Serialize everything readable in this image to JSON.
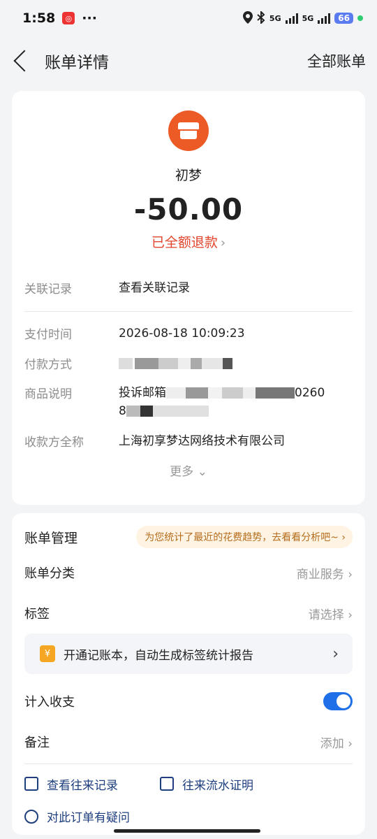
{
  "status_bar": {
    "time": "1:58",
    "dots": "···",
    "net_1": "5G",
    "net_2": "5G",
    "battery": "66"
  },
  "nav": {
    "title": "账单详情",
    "right_link": "全部账单"
  },
  "bill": {
    "merchant": "初梦",
    "amount": "-50.00",
    "refund_status": "已全额退款",
    "related_label": "关联记录",
    "related_link": "查看关联记录",
    "pay_time_label": "支付时间",
    "pay_time": "2026-08-18 10:09:23",
    "pay_method_label": "付款方式",
    "goods_label": "商品说明",
    "goods_visible_start": "投诉邮箱",
    "goods_visible_end": "0260",
    "goods_line2_start": "8",
    "payee_label": "收款方全称",
    "payee": "上海初享梦达网络技术有限公司",
    "more": "更多"
  },
  "management": {
    "title": "账单管理",
    "tip": "为您统计了最近的花费趋势，去看看分析吧~",
    "category_label": "账单分类",
    "category_value": "商业服务",
    "tag_label": "标签",
    "tag_value": "请选择",
    "promo_icon": "¥",
    "promo_text": "开通记账本，自动生成标签统计报告",
    "income_label": "计入收支",
    "income_enabled": true,
    "note_label": "备注",
    "note_value": "添加",
    "action_records": "查看往来记录",
    "action_proof": "往来流水证明",
    "action_question": "对此订单有疑问"
  }
}
